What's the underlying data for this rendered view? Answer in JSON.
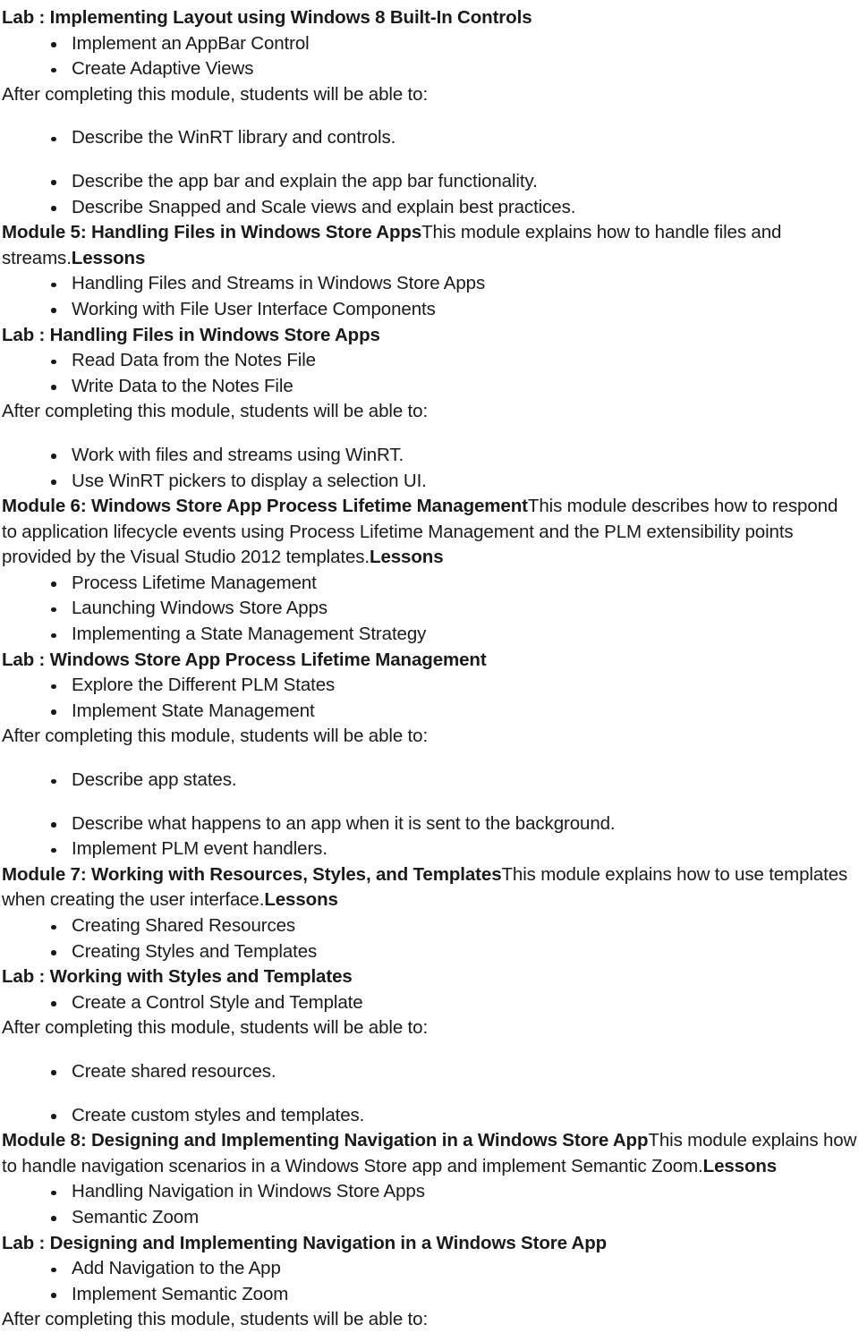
{
  "document": {
    "blocks": [
      {
        "kind": "heading",
        "text": "Lab : Implementing Layout using Windows 8 Built-In Controls"
      },
      {
        "kind": "bullets",
        "spaced": false,
        "items": [
          "Implement an AppBar Control",
          "Create Adaptive Views"
        ]
      },
      {
        "kind": "body",
        "text": "After completing this module, students will be able to:"
      },
      {
        "kind": "bullets",
        "spaced": true,
        "items": [
          "Describe the WinRT library and controls.",
          "Describe the app bar and explain the app bar functionality.",
          "Describe Snapped and Scale views and explain best practices."
        ],
        "tight_from": 2
      },
      {
        "kind": "para",
        "runs": [
          {
            "bold": true,
            "text": "Module 5: Handling Files in Windows Store Apps"
          },
          {
            "bold": false,
            "text": "This module explains how to handle files and streams."
          },
          {
            "bold": true,
            "text": "Lessons"
          }
        ]
      },
      {
        "kind": "bullets",
        "spaced": false,
        "items": [
          "Handling Files and Streams in Windows Store Apps",
          "Working with File User Interface Components"
        ]
      },
      {
        "kind": "heading",
        "text": "Lab : Handling Files in Windows Store Apps"
      },
      {
        "kind": "bullets",
        "spaced": false,
        "items": [
          "Read Data from the Notes File",
          "Write Data to the Notes File"
        ]
      },
      {
        "kind": "body",
        "text": "After completing this module, students will be able to:"
      },
      {
        "kind": "bullets",
        "spaced": true,
        "items": [
          "Work with files and streams using WinRT.",
          "Use WinRT pickers to display a selection UI."
        ],
        "tight_from": 1
      },
      {
        "kind": "para",
        "runs": [
          {
            "bold": true,
            "text": "Module 6: Windows Store App Process Lifetime Management"
          },
          {
            "bold": false,
            "text": "This module describes how to respond to application lifecycle events using Process Lifetime Management and the PLM extensibility points provided by the Visual Studio 2012 templates."
          },
          {
            "bold": true,
            "text": "Lessons"
          }
        ]
      },
      {
        "kind": "bullets",
        "spaced": false,
        "items": [
          "Process Lifetime Management",
          "Launching Windows Store Apps",
          "Implementing a State Management Strategy"
        ]
      },
      {
        "kind": "heading",
        "text": "Lab : Windows Store App Process Lifetime Management"
      },
      {
        "kind": "bullets",
        "spaced": false,
        "items": [
          "Explore the Different PLM States",
          "Implement State Management"
        ]
      },
      {
        "kind": "body",
        "text": "After completing this module, students will be able to:"
      },
      {
        "kind": "bullets",
        "spaced": true,
        "items": [
          "Describe app states.",
          "Describe what happens to an app when it is sent to the background.",
          "Implement PLM event handlers."
        ],
        "tight_from": 2
      },
      {
        "kind": "para",
        "runs": [
          {
            "bold": true,
            "text": "Module 7: Working with Resources, Styles, and Templates"
          },
          {
            "bold": false,
            "text": "This module explains how to use templates when creating the user interface."
          },
          {
            "bold": true,
            "text": "Lessons"
          }
        ]
      },
      {
        "kind": "bullets",
        "spaced": false,
        "items": [
          "Creating Shared Resources",
          "Creating Styles and Templates"
        ]
      },
      {
        "kind": "heading",
        "text": "Lab : Working with Styles and Templates"
      },
      {
        "kind": "bullets",
        "spaced": false,
        "items": [
          "Create a Control Style and Template"
        ]
      },
      {
        "kind": "body",
        "text": "After completing this module, students will be able to:"
      },
      {
        "kind": "bullets",
        "spaced": true,
        "items": [
          "Create shared resources.",
          "Create custom styles and templates."
        ]
      },
      {
        "kind": "para",
        "runs": [
          {
            "bold": true,
            "text": "Module 8: Designing and Implementing Navigation in a Windows Store App"
          },
          {
            "bold": false,
            "text": "This module explains how to handle navigation scenarios in a Windows Store app and implement Semantic Zoom."
          },
          {
            "bold": true,
            "text": "Lessons"
          }
        ]
      },
      {
        "kind": "bullets",
        "spaced": false,
        "items": [
          "Handling Navigation in Windows Store Apps",
          "Semantic Zoom"
        ]
      },
      {
        "kind": "heading",
        "text": "Lab : Designing and Implementing Navigation in a Windows Store App"
      },
      {
        "kind": "bullets",
        "spaced": false,
        "items": [
          "Add Navigation to the App",
          "Implement Semantic Zoom"
        ]
      },
      {
        "kind": "body",
        "text": "After completing this module, students will be able to:"
      }
    ]
  }
}
